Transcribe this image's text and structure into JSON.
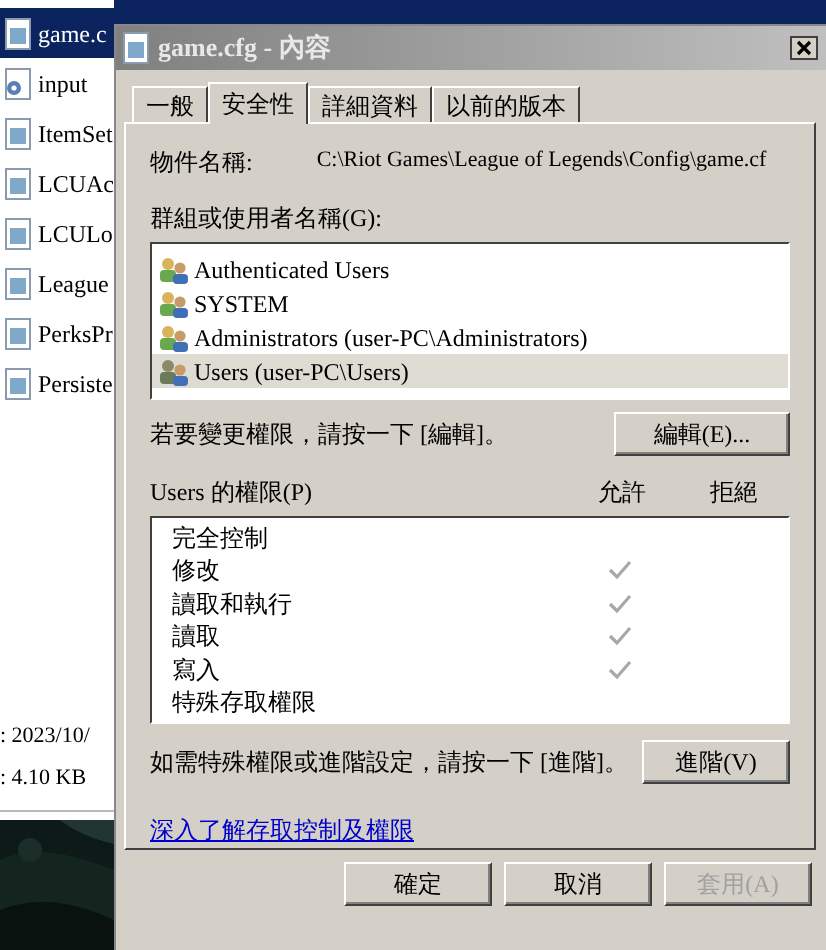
{
  "explorer": {
    "files": [
      {
        "name": "game.c",
        "kind": "file",
        "selected": true
      },
      {
        "name": "input",
        "kind": "settings",
        "selected": false
      },
      {
        "name": "ItemSet",
        "kind": "file",
        "selected": false
      },
      {
        "name": "LCUAc",
        "kind": "file",
        "selected": false
      },
      {
        "name": "LCULo",
        "kind": "file",
        "selected": false
      },
      {
        "name": "League",
        "kind": "file",
        "selected": false
      },
      {
        "name": "PerksPr",
        "kind": "file",
        "selected": false
      },
      {
        "name": "Persiste",
        "kind": "file",
        "selected": false
      }
    ],
    "details": [
      ": 2023/10/",
      ": 4.10 KB"
    ]
  },
  "dialog": {
    "title": "game.cfg - 內容",
    "tabs": [
      {
        "label": "一般",
        "selected": false
      },
      {
        "label": "安全性",
        "selected": true
      },
      {
        "label": "詳細資料",
        "selected": false
      },
      {
        "label": "以前的版本",
        "selected": false
      }
    ],
    "object_label": "物件名稱:",
    "object_path": "C:\\Riot Games\\League of Legends\\Config\\game.cf",
    "groups_label": "群組或使用者名稱(G):",
    "groups": [
      {
        "name": "Authenticated Users",
        "selected": false
      },
      {
        "name": "SYSTEM",
        "selected": false
      },
      {
        "name": "Administrators (user-PC\\Administrators)",
        "selected": false
      },
      {
        "name": "Users (user-PC\\Users)",
        "selected": true
      }
    ],
    "edit_hint": "若要變更權限，請按一下 [編輯]。",
    "edit_button": "編輯(E)...",
    "permissions_label": "Users 的權限(P)",
    "allow_label": "允許",
    "deny_label": "拒絕",
    "permissions": [
      {
        "name": "完全控制",
        "allow": false,
        "deny": false
      },
      {
        "name": "修改",
        "allow": true,
        "deny": false
      },
      {
        "name": "讀取和執行",
        "allow": true,
        "deny": false
      },
      {
        "name": "讀取",
        "allow": true,
        "deny": false
      },
      {
        "name": "寫入",
        "allow": true,
        "deny": false
      },
      {
        "name": "特殊存取權限",
        "allow": false,
        "deny": false
      }
    ],
    "advanced_hint": "如需特殊權限或進階設定，請按一下 [進階]。",
    "advanced_button": "進階(V)",
    "link": "深入了解存取控制及權限",
    "buttons": [
      {
        "label": "確定",
        "disabled": false
      },
      {
        "label": "取消",
        "disabled": false
      },
      {
        "label": "套用(A)",
        "disabled": true
      }
    ]
  }
}
